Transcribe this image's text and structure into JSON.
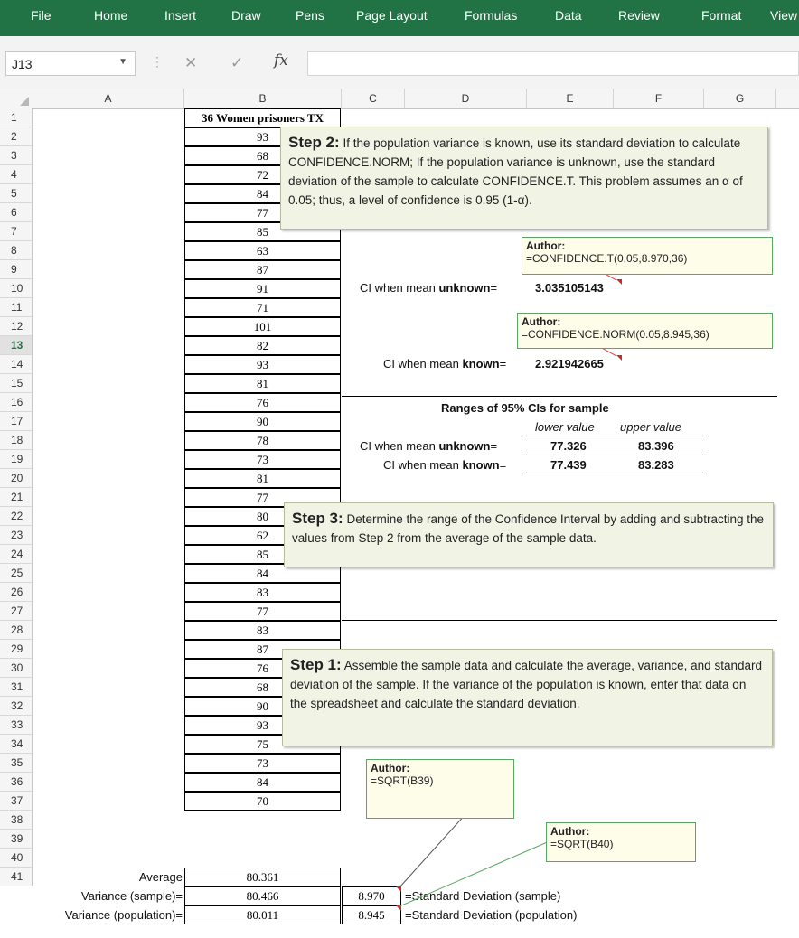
{
  "ribbon": {
    "menus": [
      "File",
      "Home",
      "Insert",
      "Draw",
      "Pens",
      "Page Layout",
      "Formulas",
      "Data",
      "Review",
      "Format",
      "View"
    ]
  },
  "formula_bar": {
    "cell_ref": "J13",
    "fx": "fx",
    "formula": ""
  },
  "columns": [
    "A",
    "B",
    "C",
    "D",
    "E",
    "F",
    "G"
  ],
  "rows": [
    "1",
    "2",
    "3",
    "4",
    "5",
    "6",
    "7",
    "8",
    "9",
    "10",
    "11",
    "12",
    "13",
    "14",
    "15",
    "16",
    "17",
    "18",
    "19",
    "20",
    "21",
    "22",
    "23",
    "24",
    "25",
    "26",
    "27",
    "28",
    "29",
    "30",
    "31",
    "32",
    "33",
    "34",
    "35",
    "36",
    "37",
    "38",
    "39",
    "40",
    "41"
  ],
  "active_row": "13",
  "sheet": {
    "b_header": "36 Women prisoners TX",
    "b_values": [
      "93",
      "68",
      "72",
      "84",
      "77",
      "85",
      "63",
      "87",
      "91",
      "71",
      "101",
      "82",
      "93",
      "81",
      "76",
      "90",
      "78",
      "73",
      "81",
      "77",
      "80",
      "62",
      "85",
      "84",
      "83",
      "77",
      "83",
      "87",
      "76",
      "68",
      "90",
      "93",
      "75",
      "73",
      "84",
      "70"
    ],
    "summary": [
      {
        "label": "Average",
        "b": "80.361",
        "c": "",
        "d": ""
      },
      {
        "label": "Variance (sample)=",
        "b": "80.466",
        "c": "8.970",
        "d": "=Standard Deviation (sample)"
      },
      {
        "label": "Variance (population)=",
        "b": "80.011",
        "c": "8.945",
        "d": "=Standard Deviation (population)"
      }
    ],
    "ci_unknown": {
      "label_pre": "CI when mean ",
      "label_bold": "unknown",
      "label_post": "=",
      "value": "3.035105143"
    },
    "ci_known": {
      "label_pre": "CI when mean ",
      "label_bold": "known",
      "label_post": "=",
      "value": "2.921942665"
    },
    "ranges": {
      "title": "Ranges of 95% CIs for sample",
      "lower_header": "lower value",
      "upper_header": "upper value",
      "rows": [
        {
          "pre": "CI when mean ",
          "bold": "unknown",
          "post": "=",
          "lower": "77.326",
          "upper": "83.396"
        },
        {
          "pre": "CI when mean ",
          "bold": "known",
          "post": "=",
          "lower": "77.439",
          "upper": "83.283"
        }
      ]
    }
  },
  "notes": {
    "step2": {
      "title": "Step 2:",
      "text": " If the population variance is known, use its standard deviation to calculate CONFIDENCE.NORM; If the population variance is unknown, use the standard deviation of the sample to calculate CONFIDENCE.T. This problem assumes an α of 0.05; thus, a level of confidence is 0.95 (1-α)."
    },
    "step3": {
      "title": "Step 3:",
      "text": " Determine the range of the Confidence Interval by adding and subtracting the values from Step 2 from the average of the sample data."
    },
    "step1": {
      "title": "Step 1:",
      "text": " Assemble the sample data and calculate the average, variance, and standard deviation of the sample. If the variance of the population is known, enter that data on the spreadsheet and calculate the standard deviation."
    }
  },
  "comments": [
    {
      "author": "Author:",
      "formula": "=CONFIDENCE.T(0.05,8.970,36)"
    },
    {
      "author": "Author:",
      "formula": "=CONFIDENCE.NORM(0.05,8.945,36)"
    },
    {
      "author": "Author:",
      "formula": "=SQRT(B39)"
    },
    {
      "author": "Author:",
      "formula": "=SQRT(B40)"
    }
  ],
  "colors": {
    "ribbon": "#217346",
    "note_bg": "#f1f3e5",
    "comment_border": "#5aa765",
    "comment_marker": "#d0262d"
  }
}
